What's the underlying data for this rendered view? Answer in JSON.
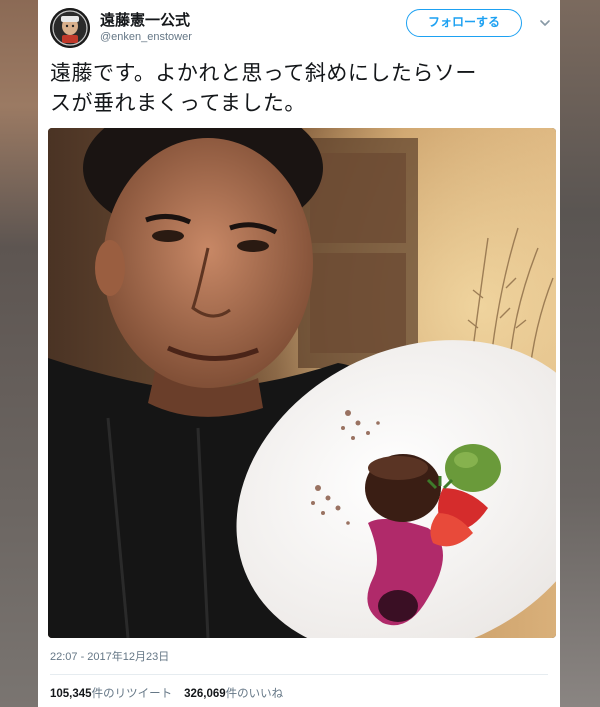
{
  "tweet": {
    "display_name": "遠藤憲一公式",
    "handle": "@enken_enstower",
    "follow_label": "フォローする",
    "text_line1": "遠藤です。よかれと思って斜めにしたらソー",
    "text_line2": "スが垂れまくってました。",
    "timestamp": "22:07 - 2017年12月23日",
    "retweet_count": "105,345",
    "retweet_label": "件のリツイート",
    "like_count": "326,069",
    "like_label": "件のいいね"
  },
  "colors": {
    "accent": "#1da1f2",
    "text": "#14171a",
    "muted": "#657786"
  },
  "icons": {
    "menu": "chevron-down-icon"
  }
}
